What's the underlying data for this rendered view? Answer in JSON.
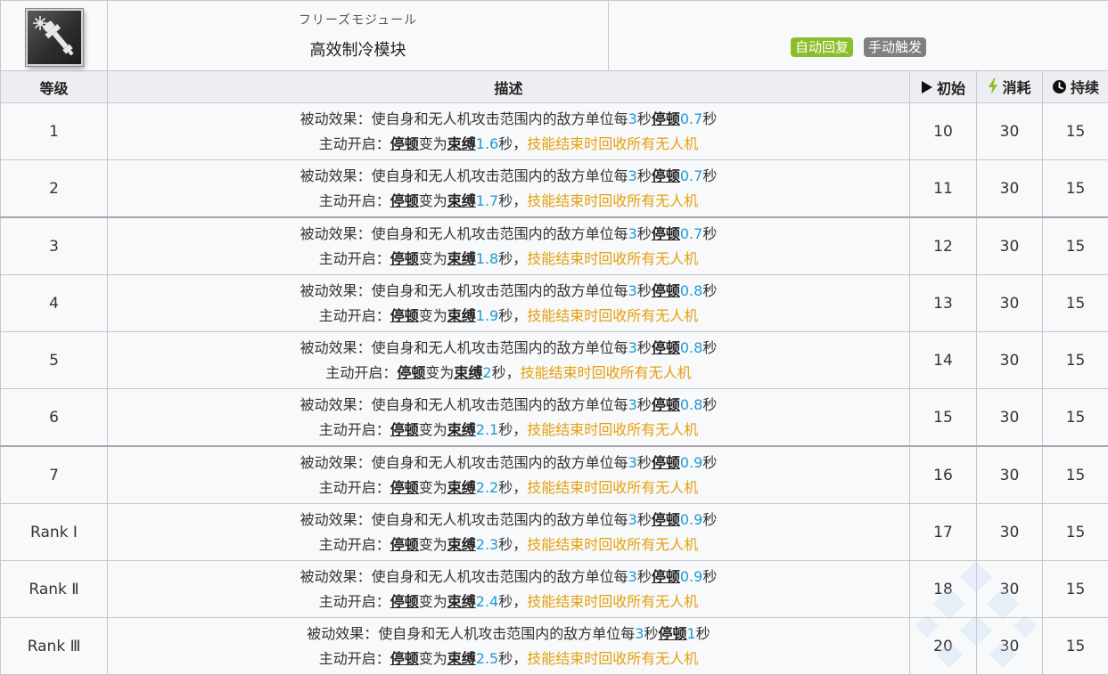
{
  "header": {
    "icon": "drone-module-icon",
    "title_jp": "フリーズモジュール",
    "title_cn": "高效制冷模块",
    "tags": [
      {
        "label": "自动回复",
        "color": "#8bbf2a"
      },
      {
        "label": "手动触发",
        "color": "#808080"
      }
    ]
  },
  "columns": {
    "level": "等级",
    "description": "描述",
    "initial": "初始",
    "cost": "消耗",
    "duration": "持续"
  },
  "text": {
    "passive_prefix": "被动效果：使自身和无人机攻击范围内的敌方单位每",
    "sec": "秒",
    "stun": "停顿",
    "active_prefix": "主动开启：",
    "becomes": "变为",
    "bind": "束缚",
    "sec_comma": "秒，",
    "recall": "技能结束时回收所有无人机"
  },
  "rows": [
    {
      "level": "1",
      "interval": "3",
      "stun_time": "0.7",
      "bind_time": "1.6",
      "initial": "10",
      "cost": "30",
      "duration": "15"
    },
    {
      "level": "2",
      "interval": "3",
      "stun_time": "0.7",
      "bind_time": "1.7",
      "initial": "11",
      "cost": "30",
      "duration": "15"
    },
    {
      "level": "3",
      "interval": "3",
      "stun_time": "0.7",
      "bind_time": "1.8",
      "initial": "12",
      "cost": "30",
      "duration": "15"
    },
    {
      "level": "4",
      "interval": "3",
      "stun_time": "0.8",
      "bind_time": "1.9",
      "initial": "13",
      "cost": "30",
      "duration": "15"
    },
    {
      "level": "5",
      "interval": "3",
      "stun_time": "0.8",
      "bind_time": "2",
      "initial": "14",
      "cost": "30",
      "duration": "15"
    },
    {
      "level": "6",
      "interval": "3",
      "stun_time": "0.8",
      "bind_time": "2.1",
      "initial": "15",
      "cost": "30",
      "duration": "15"
    },
    {
      "level": "7",
      "interval": "3",
      "stun_time": "0.9",
      "bind_time": "2.2",
      "initial": "16",
      "cost": "30",
      "duration": "15"
    },
    {
      "level": "Rank Ⅰ",
      "interval": "3",
      "stun_time": "0.9",
      "bind_time": "2.3",
      "initial": "17",
      "cost": "30",
      "duration": "15"
    },
    {
      "level": "Rank Ⅱ",
      "interval": "3",
      "stun_time": "0.9",
      "bind_time": "2.4",
      "initial": "18",
      "cost": "30",
      "duration": "15"
    },
    {
      "level": "Rank Ⅲ",
      "interval": "3",
      "stun_time": "1",
      "bind_time": "2.5",
      "initial": "20",
      "cost": "30",
      "duration": "15"
    }
  ],
  "icons": {
    "initial": "play-icon",
    "cost": "lightning-icon",
    "duration": "clock-icon",
    "watermark": "diamond-watermark-icon"
  },
  "colors": {
    "number": "#1e9ad6",
    "highlight": "#e5a00d",
    "auto_recover": "#8bbf2a",
    "manual": "#808080",
    "lightning": "#8bbf2a"
  }
}
